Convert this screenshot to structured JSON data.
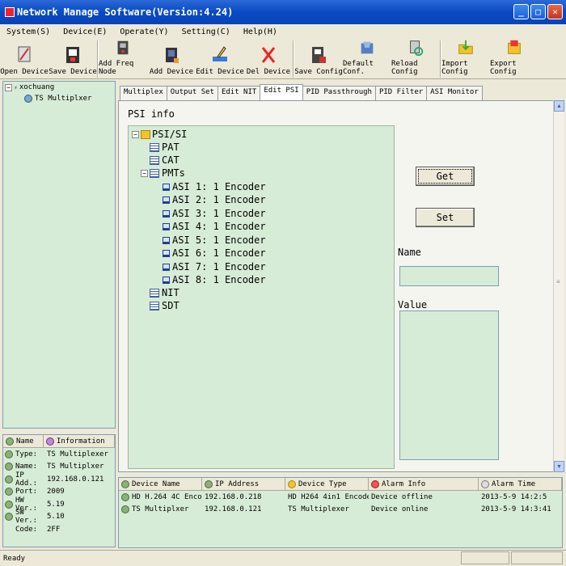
{
  "window": {
    "title": "Network Manage Software(Version:4.24)"
  },
  "menu": [
    "System(S)",
    "Device(E)",
    "Operate(Y)",
    "Setting(C)",
    "Help(H)"
  ],
  "toolbar": [
    "Open Device",
    "Save Device",
    "Add Freq Node",
    "Add Device",
    "Edit Device",
    "Del Device",
    "Save Config",
    "Default Conf.",
    "Reload Config",
    "Import Config",
    "Export Config"
  ],
  "left_tree": {
    "root": "xochuang",
    "child": "TS Multiplxer"
  },
  "tabs": [
    "Multiplex",
    "Output Set",
    "Edit NIT",
    "Edit PSI",
    "PID Passthrough",
    "PID Filter",
    "ASI Monitor"
  ],
  "active_tab": "Edit PSI",
  "psi": {
    "title": "PSI info",
    "root": "PSI/SI",
    "pat": "PAT",
    "cat": "CAT",
    "pmts": "PMTs",
    "pmt_items": [
      "ASI 1: 1 Encoder",
      "ASI 2: 1 Encoder",
      "ASI 3: 1 Encoder",
      "ASI 4: 1 Encoder",
      "ASI 5: 1 Encoder",
      "ASI 6: 1 Encoder",
      "ASI 7: 1 Encoder",
      "ASI 8: 1 Encoder"
    ],
    "nit": "NIT",
    "sdt": "SDT"
  },
  "buttons": {
    "get": "Get",
    "set": "Set"
  },
  "fields": {
    "name_label": "Name",
    "value_label": "Value",
    "name_value": "",
    "value_value": ""
  },
  "info": {
    "headers": [
      "Name",
      "Information"
    ],
    "rows": [
      [
        "Type:",
        "TS Multiplexer"
      ],
      [
        "Name:",
        "TS Multiplxer"
      ],
      [
        "IP Add.:",
        "192.168.0.121"
      ],
      [
        "Port:",
        "2009"
      ],
      [
        "HW Ver.:",
        "5.19"
      ],
      [
        "SW Ver.:",
        "5.10"
      ],
      [
        "Code:",
        "2FF"
      ]
    ]
  },
  "devices": {
    "headers": [
      "Device Name",
      "IP Address",
      "Device Type",
      "Alarm Info",
      "Alarm Time"
    ],
    "rows": [
      [
        "HD H.264 4C Encoder",
        "192.168.0.218",
        "HD H264 4in1 Encoder",
        "Device offline",
        "2013-5-9 14:2:5"
      ],
      [
        "TS Multiplxer",
        "192.168.0.121",
        "TS Multiplexer",
        "Device online",
        "2013-5-9 14:3:41"
      ]
    ]
  },
  "status": "Ready",
  "colors": {
    "title_blue": "#0a4ac4",
    "panel_green": "#d7ecd6"
  },
  "icons": [
    "open-device-icon",
    "save-device-icon",
    "add-freq-node-icon",
    "add-device-icon",
    "edit-device-icon",
    "delete-device-icon",
    "save-config-icon",
    "default-config-icon",
    "reload-config-icon",
    "import-config-icon",
    "export-config-icon"
  ]
}
